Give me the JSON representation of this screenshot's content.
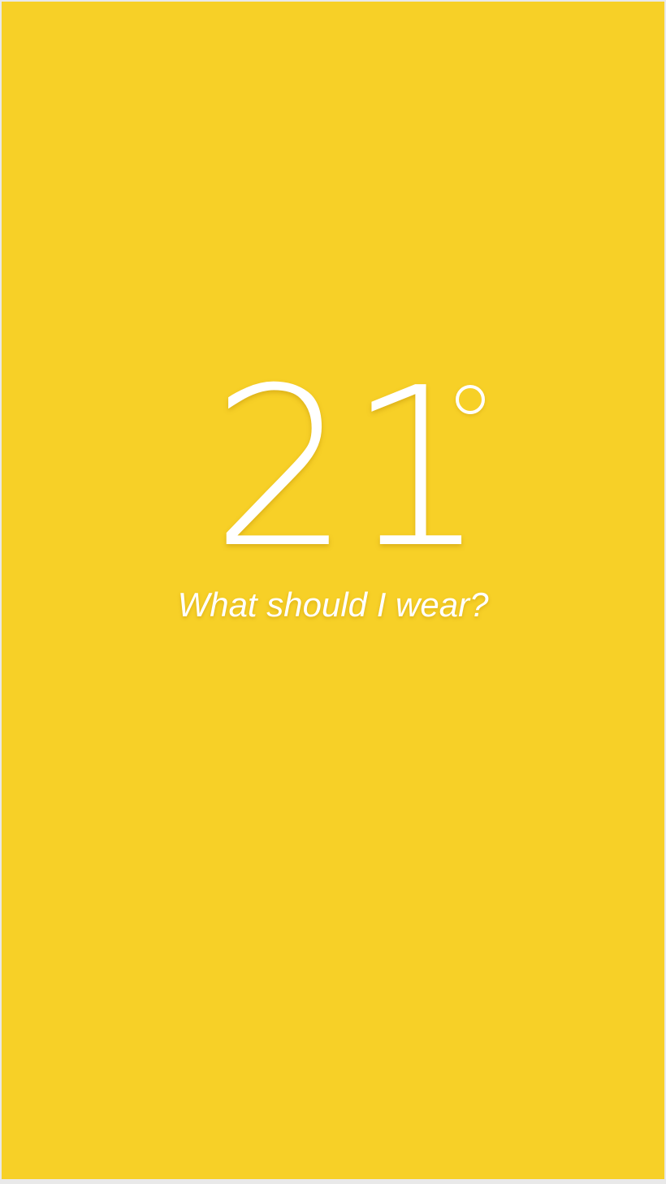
{
  "weather": {
    "temperature": "21",
    "degree_icon": "degree-circle",
    "prompt": "What should I wear?"
  },
  "colors": {
    "background": "#f7d027",
    "text": "#ffffff"
  }
}
